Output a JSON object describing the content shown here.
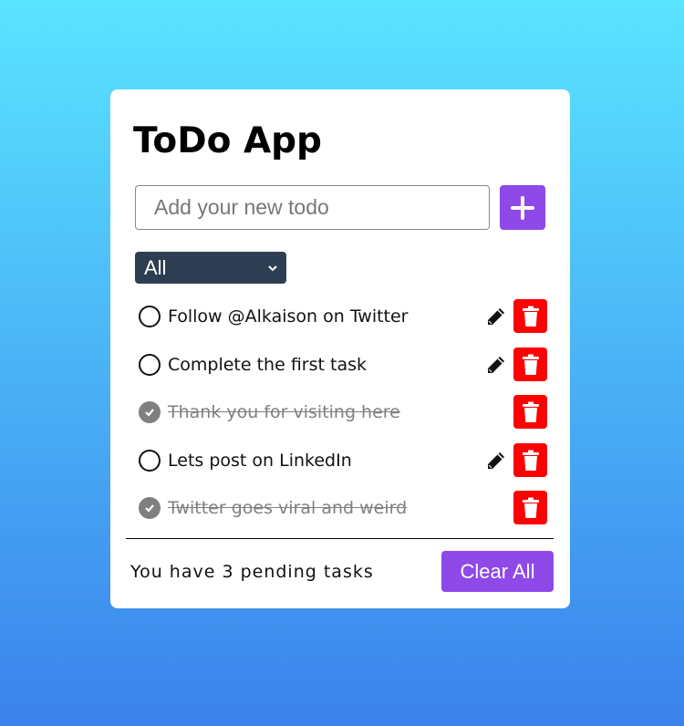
{
  "app": {
    "title": "ToDo App"
  },
  "input": {
    "placeholder": "Add your new todo",
    "value": ""
  },
  "add_button": {
    "icon": "plus-icon"
  },
  "filter": {
    "selected": "All"
  },
  "todos": [
    {
      "text": "Follow @Alkaison on Twitter",
      "completed": false
    },
    {
      "text": "Complete the first task",
      "completed": false
    },
    {
      "text": "Thank you for visiting here",
      "completed": true
    },
    {
      "text": "Lets post on LinkedIn",
      "completed": false
    },
    {
      "text": "Twitter goes viral and weird",
      "completed": true
    }
  ],
  "footer": {
    "pending_text": "You have 3 pending tasks",
    "clear_label": "Clear All"
  },
  "colors": {
    "accent": "#8e49e8",
    "delete": "#ff0000",
    "filter_bg": "#2e3e52"
  }
}
